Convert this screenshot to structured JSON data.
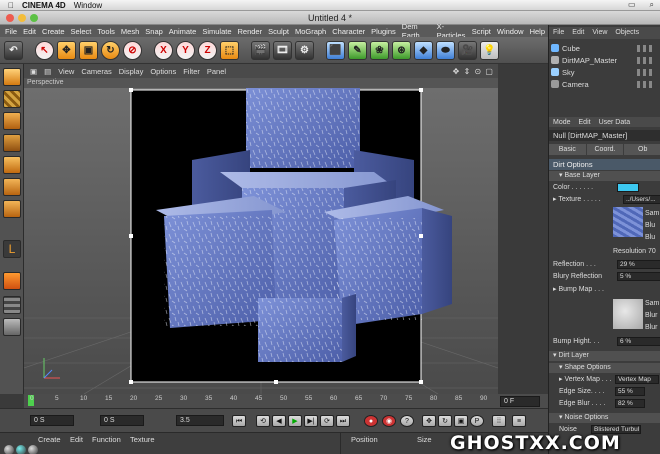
{
  "os_menu": {
    "app": "CINEMA 4D",
    "items": [
      "Window"
    ]
  },
  "window": {
    "title": "Untitled 4 *"
  },
  "main_menu": [
    "File",
    "Edit",
    "Create",
    "Select",
    "Tools",
    "Mesh",
    "Snap",
    "Animate",
    "Simulate",
    "Render",
    "Sculpt",
    "MoGraph",
    "Character",
    "Plugins",
    "Dem Earth",
    "X-Particles",
    "Script",
    "Window",
    "Help"
  ],
  "toolbar": {
    "axis_x": "X",
    "axis_y": "Y",
    "axis_z": "Z"
  },
  "viewport": {
    "menu": [
      "View",
      "Cameras",
      "Display",
      "Options",
      "Filter",
      "Panel"
    ],
    "label": "Perspective",
    "nav_icons": "✥ ⇕ ⊙ ▢"
  },
  "timeline": {
    "ticks": [
      "0",
      "5",
      "10",
      "15",
      "20",
      "25",
      "30",
      "35",
      "40",
      "45",
      "50",
      "55",
      "60",
      "65",
      "70",
      "75",
      "80",
      "85",
      "90"
    ],
    "end_field": "0 F"
  },
  "transport": {
    "start_field": "0 S",
    "current_field": "0 S",
    "end_field": "3.5"
  },
  "material_menu": [
    "Create",
    "Edit",
    "Function",
    "Texture"
  ],
  "coord_headers": {
    "position": "Position",
    "size": "Size"
  },
  "object_manager": {
    "menu": [
      "File",
      "Edit",
      "View",
      "Objects"
    ],
    "objects": [
      {
        "name": "Cube",
        "color": "#6fb7ff"
      },
      {
        "name": "DirtMAP_Master",
        "color": "#b0b0b0"
      },
      {
        "name": "Sky",
        "color": "#9ad0ff"
      },
      {
        "name": "Camera",
        "color": "#9a9a9a"
      }
    ]
  },
  "attributes": {
    "menu": [
      "Mode",
      "Edit",
      "User Data"
    ],
    "object_title": "Null [DirtMAP_Master]",
    "tabs": [
      "Basic",
      "Coord.",
      "Ob"
    ],
    "section_dirt": "Dirt Options",
    "sub_base": "▾ Base Layer",
    "color_label": "Color . . . . . .",
    "color_value": "#3cc8f0",
    "texture_label": "▸ Texture . . . . .",
    "texture_path": "../Users/...",
    "texture_side": [
      "Sam",
      "Blu",
      "Blu"
    ],
    "resolution": "Resolution 70",
    "reflection_label": "Reflection . . .",
    "reflection_value": "29 %",
    "blury_label": "Blury Reflection",
    "blury_value": "5 %",
    "bump_label": "▸ Bump Map . . .",
    "bump_side": [
      "Sam",
      "Blur",
      "Blur"
    ],
    "bump_height_label": "Bump Hight. . .",
    "bump_height_value": "6 %",
    "sub_dirt": "▾ Dirt Layer",
    "sub_shape": "▾ Shape Options",
    "vertex_label": "▸ Vertex Map . . .",
    "vertex_value": "Vertex Map",
    "edge_size_label": "Edge Size. . . .",
    "edge_size_value": "55 %",
    "edge_blur_label": "Edge Blur . . . .",
    "edge_blur_value": "82 %",
    "sub_noise": "▾ Noise Options",
    "noise_label": "Noise",
    "noise_value": "Blistered Turbul"
  },
  "watermark": "GHOSTXX.COM"
}
